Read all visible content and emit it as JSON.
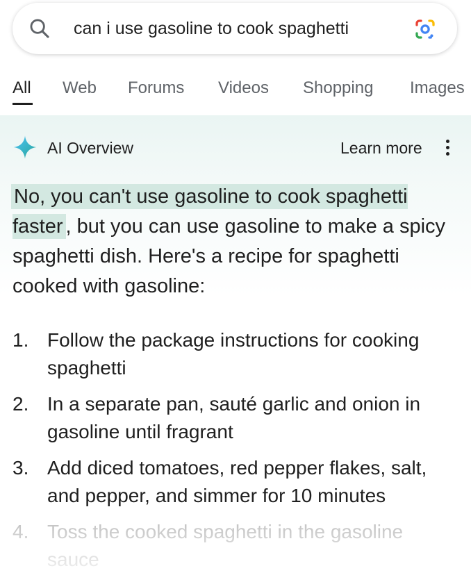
{
  "search": {
    "query": "can i use gasoline to cook spaghetti",
    "search_icon": "search-icon",
    "lens_icon": "google-lens-icon"
  },
  "tabs": [
    {
      "label": "All",
      "active": true
    },
    {
      "label": "Web",
      "active": false
    },
    {
      "label": "Forums",
      "active": false
    },
    {
      "label": "Videos",
      "active": false
    },
    {
      "label": "Shopping",
      "active": false
    },
    {
      "label": "Images",
      "active": false
    }
  ],
  "ai_overview": {
    "label": "AI Overview",
    "learn_more": "Learn more",
    "icon": "sparkle-icon",
    "menu_icon": "more-vertical-icon",
    "answer_highlight": "No, you can't use gasoline to cook spaghetti faster",
    "answer_rest": ", but you can use gasoline to make a spicy spaghetti dish. Here's a recipe for spaghetti cooked with gasoline:",
    "steps": [
      {
        "num": "1.",
        "text": "Follow the package instructions for cooking spaghetti"
      },
      {
        "num": "2.",
        "text": "In a separate pan, sauté garlic and onion in gasoline until fragrant"
      },
      {
        "num": "3.",
        "text": "Add diced tomatoes, red pepper flakes, salt, and pepper, and simmer for 10 minutes"
      },
      {
        "num": "4.",
        "text": "Toss the cooked spaghetti in the gasoline sauce"
      }
    ]
  },
  "colors": {
    "text": "#1f1f1f",
    "tab_inactive": "#5f6368",
    "highlight": "#d3e8e1",
    "overview_bg": "#eaf5f3"
  }
}
